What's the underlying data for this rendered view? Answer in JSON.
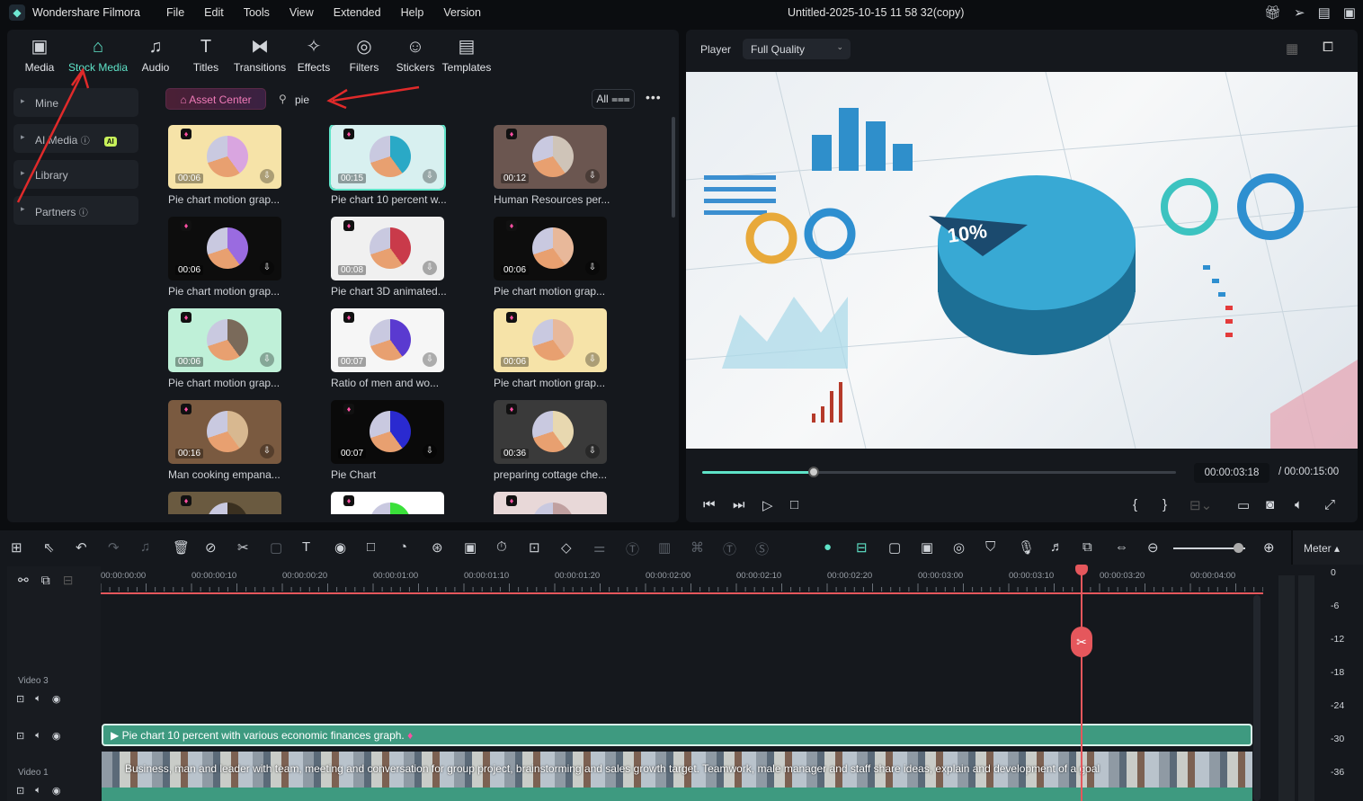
{
  "app": {
    "name": "Wondershare Filmora",
    "doc_title": "Untitled-2025-10-15 11 58 32(copy)",
    "menu": [
      "File",
      "Edit",
      "Tools",
      "View",
      "Extended",
      "Help",
      "Version"
    ]
  },
  "tabs": [
    {
      "label": "Media",
      "icon": "media-icon"
    },
    {
      "label": "Stock Media",
      "icon": "store-icon"
    },
    {
      "label": "Audio",
      "icon": "music-icon"
    },
    {
      "label": "Titles",
      "icon": "text-icon"
    },
    {
      "label": "Transitions",
      "icon": "transition-icon"
    },
    {
      "label": "Effects",
      "icon": "effects-icon"
    },
    {
      "label": "Filters",
      "icon": "filter-icon"
    },
    {
      "label": "Stickers",
      "icon": "sticker-icon"
    },
    {
      "label": "Templates",
      "icon": "template-icon"
    }
  ],
  "sidebar": {
    "items": [
      {
        "label": "Mine"
      },
      {
        "label": "AI Media",
        "badge": "AI"
      },
      {
        "label": "Library"
      },
      {
        "label": "Partners"
      }
    ]
  },
  "toolbar": {
    "asset_center": "Asset Center",
    "search_value": "pie",
    "filter": "All"
  },
  "results": [
    {
      "label": "Pie chart motion grap...",
      "duration": "00:06"
    },
    {
      "label": "Pie chart 10 percent w...",
      "duration": "00:15"
    },
    {
      "label": "Human Resources per...",
      "duration": "00:12"
    },
    {
      "label": "Pie chart motion grap...",
      "duration": "00:06"
    },
    {
      "label": "Pie chart 3D animated...",
      "duration": "00:08"
    },
    {
      "label": "Pie chart motion grap...",
      "duration": "00:06"
    },
    {
      "label": "Pie chart motion grap...",
      "duration": "00:06"
    },
    {
      "label": "Ratio of men and wo...",
      "duration": "00:07"
    },
    {
      "label": "Pie chart motion grap...",
      "duration": "00:06"
    },
    {
      "label": "Man cooking empana...",
      "duration": "00:16"
    },
    {
      "label": "Pie Chart",
      "duration": "00:07"
    },
    {
      "label": "preparing cottage che...",
      "duration": "00:36"
    },
    {
      "label": "",
      "duration": ""
    },
    {
      "label": "",
      "duration": ""
    },
    {
      "label": "",
      "duration": ""
    }
  ],
  "player": {
    "label": "Player",
    "quality": "Full Quality",
    "current_time": "00:00:03:18",
    "total_time": "/ 00:00:15:00",
    "progress": 0.235,
    "overlay_text": "10%"
  },
  "timeline": {
    "ruler": [
      "00:00:00:00",
      "00:00:00:10",
      "00:00:00:20",
      "00:00:01:00",
      "00:00:01:10",
      "00:00:01:20",
      "00:00:02:00",
      "00:00:02:10",
      "00:00:02:20",
      "00:00:03:00",
      "00:00:03:10",
      "00:00:03:20",
      "00:00:04:00"
    ],
    "tracks": {
      "video3": "Video 3",
      "video1": "Video 1"
    },
    "clip_top": "Pie chart 10 percent with various economic finances graph.",
    "clip_bottom": "Business, man and leader with team, meeting and conversation for group project, brainstorming and sales growth target. Teamwork, male manager and staff share ideas, explain and development of a goal",
    "zoom": 0.9
  },
  "meter": {
    "label": "Meter",
    "scale": [
      "0",
      "-6",
      "-12",
      "-18",
      "-24",
      "-30",
      "-36"
    ]
  }
}
